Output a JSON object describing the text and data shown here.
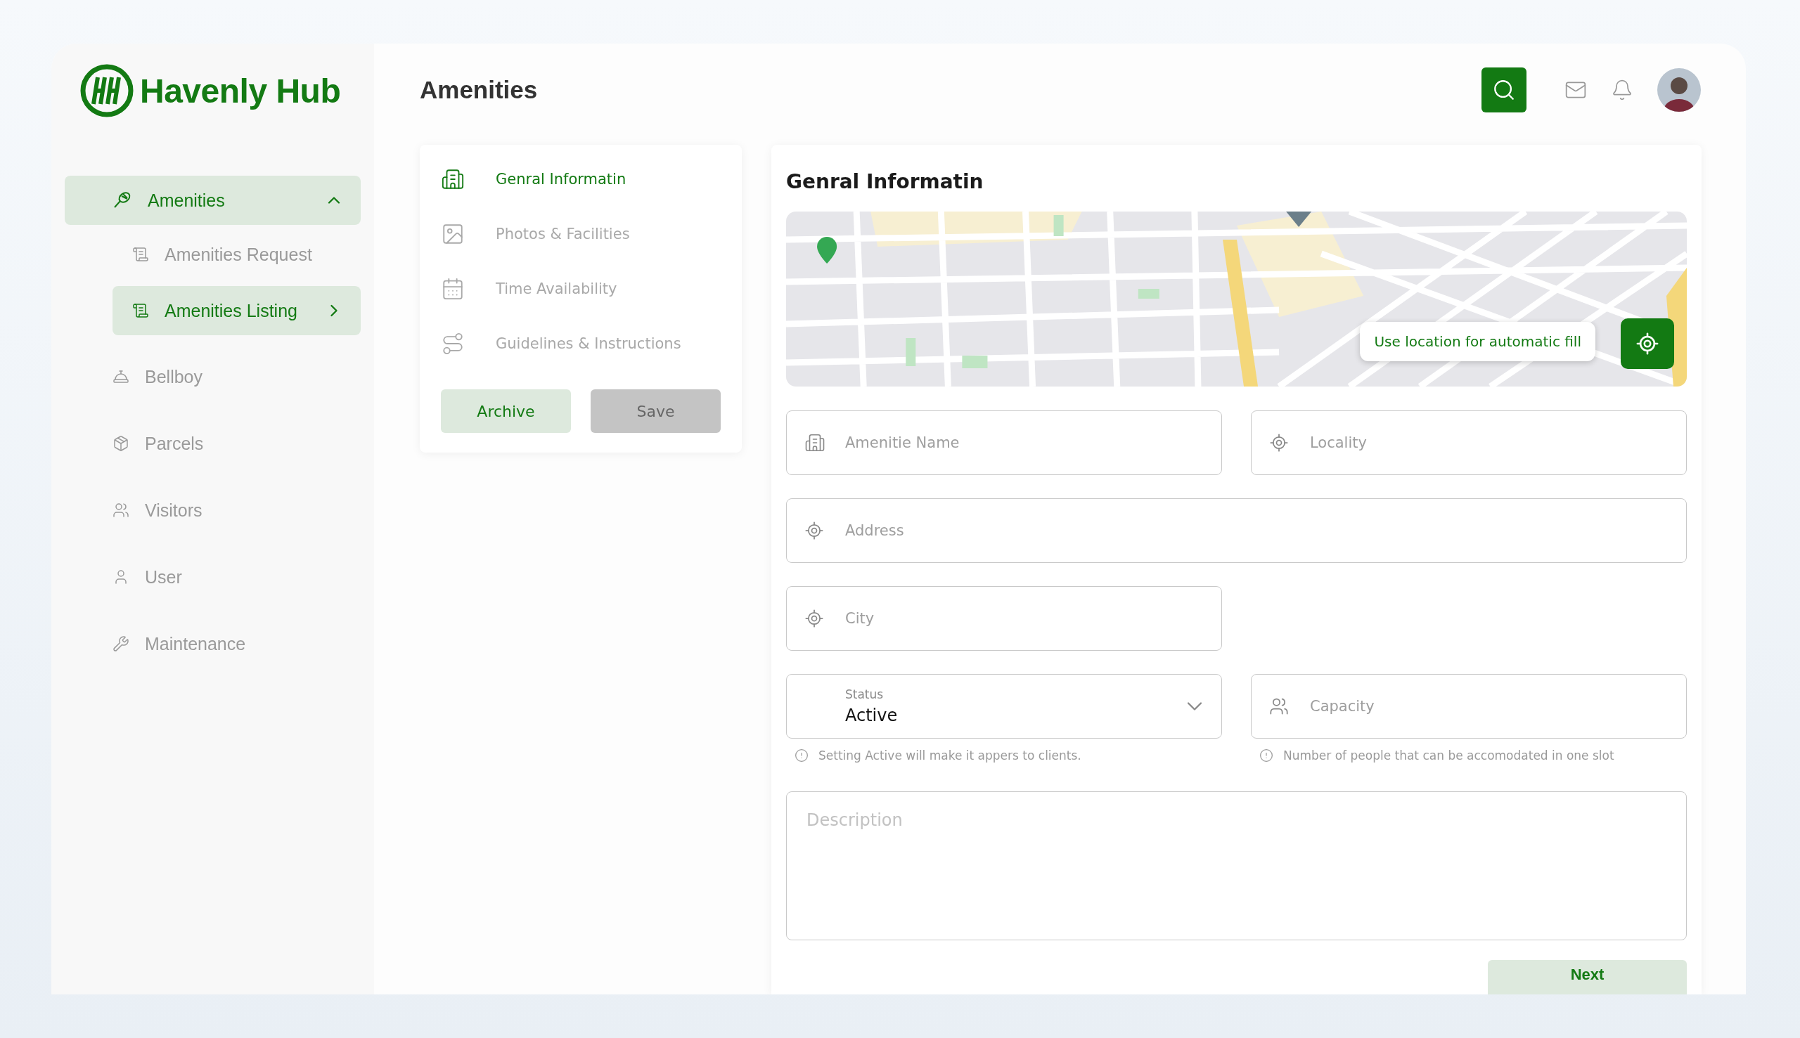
{
  "brand": {
    "name": "Havenly Hub"
  },
  "sidebar": {
    "items": [
      {
        "label": "Amenities",
        "selected": true,
        "expanded": true,
        "children": [
          {
            "label": "Amenities Request",
            "selected": false
          },
          {
            "label": "Amenities Listing",
            "selected": true
          }
        ]
      },
      {
        "label": "Bellboy",
        "selected": false
      },
      {
        "label": "Parcels",
        "selected": false
      },
      {
        "label": "Visitors",
        "selected": false
      },
      {
        "label": "User",
        "selected": false
      },
      {
        "label": "Maintenance",
        "selected": false
      }
    ]
  },
  "header": {
    "title": "Amenities"
  },
  "steps": [
    {
      "label": "Genral Informatin",
      "selected": true
    },
    {
      "label": "Photos & Facilities",
      "selected": false
    },
    {
      "label": "Time Availability",
      "selected": false
    },
    {
      "label": "Guidelines & Instructions",
      "selected": false
    }
  ],
  "step_buttons": [
    {
      "label": "Archive",
      "disabled": false
    },
    {
      "label": "Save",
      "disabled": true
    }
  ],
  "form": {
    "title": "Genral Informatin",
    "map": {
      "kind": "picture",
      "action_label": "Use location for automatic fill"
    },
    "rows": [
      {
        "fields": [
          {
            "kind": "name",
            "placeholder": "Amenitie Name",
            "wide": false
          },
          {
            "kind": "location",
            "placeholder": "Locality",
            "wide": false
          }
        ]
      },
      {
        "fields": [
          {
            "kind": "location",
            "placeholder": "Address",
            "wide": true
          }
        ]
      },
      {
        "fields": [
          {
            "kind": "location",
            "placeholder": "City",
            "wide": false
          }
        ]
      },
      {
        "fields": [
          {
            "kind": "select",
            "label": "Status",
            "value": "Active",
            "hint": "Setting Active will make it appers to clients.",
            "wide": false
          },
          {
            "kind": "capacity",
            "placeholder": "Capacity",
            "hint": "Number of people that can be accomodated in one slot",
            "wide": false
          }
        ]
      },
      {
        "fields": [
          {
            "kind": "textarea",
            "placeholder": "Description",
            "wide": true
          }
        ]
      }
    ],
    "next_button": "Next"
  }
}
